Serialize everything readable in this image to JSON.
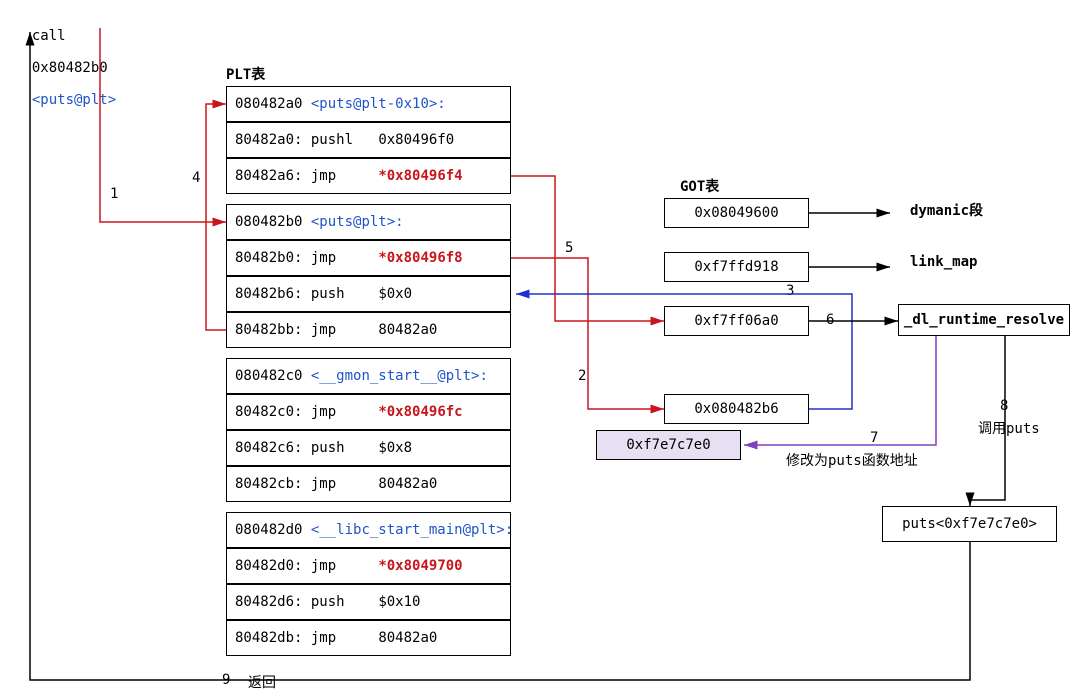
{
  "title_line": {
    "call": "call",
    "addr": "0x80482b0",
    "sym": "<puts@plt>"
  },
  "plt_title": "PLT表",
  "got_title": "GOT表",
  "plt": [
    {
      "addr": "080482a0",
      "sym": "<puts@plt-0x10>:"
    },
    {
      "addr": "80482a0:",
      "op": "pushl",
      "arg": "0x80496f0"
    },
    {
      "addr": "80482a6:",
      "op": "jmp",
      "arg": "*0x80496f4",
      "arg_red": true
    },
    {
      "addr": "080482b0",
      "sym": "<puts@plt>:"
    },
    {
      "addr": "80482b0:",
      "op": "jmp",
      "arg": "*0x80496f8",
      "arg_red": true
    },
    {
      "addr": "80482b6:",
      "op": "push",
      "arg": "$0x0"
    },
    {
      "addr": "80482bb:",
      "op": "jmp",
      "arg": "80482a0"
    },
    {
      "addr": "080482c0",
      "sym": "<__gmon_start__@plt>:"
    },
    {
      "addr": "80482c0:",
      "op": "jmp",
      "arg": "*0x80496fc",
      "arg_red": true
    },
    {
      "addr": "80482c6:",
      "op": "push",
      "arg": "$0x8"
    },
    {
      "addr": "80482cb:",
      "op": "jmp",
      "arg": "80482a0"
    },
    {
      "addr": "080482d0",
      "sym": "<__libc_start_main@plt>:"
    },
    {
      "addr": "80482d0:",
      "op": "jmp",
      "arg": "*0x8049700",
      "arg_red": true
    },
    {
      "addr": "80482d6:",
      "op": "push",
      "arg": "$0x10"
    },
    {
      "addr": "80482db:",
      "op": "jmp",
      "arg": "80482a0"
    }
  ],
  "got": [
    {
      "val": "0x08049600",
      "right": "dymanic段"
    },
    {
      "val": "0xf7ffd918",
      "right": "link_map"
    },
    {
      "val": "0xf7ff06a0",
      "right": "_dl_runtime_resolve",
      "rbox": true
    },
    {
      "val": "0x080482b6"
    }
  ],
  "got_overwrite": "0xf7e7c7e0",
  "rt_result": "puts<0xf7e7c7e0>",
  "edge_labels": {
    "e1": "1",
    "e2": "2",
    "e3": "3",
    "e4": "4",
    "e5": "5",
    "e6": "6",
    "e7": "7",
    "e7txt": "修改为puts函数地址",
    "e8": "8",
    "e8txt": "调用puts",
    "e9": "9",
    "e9txt": "返回"
  }
}
